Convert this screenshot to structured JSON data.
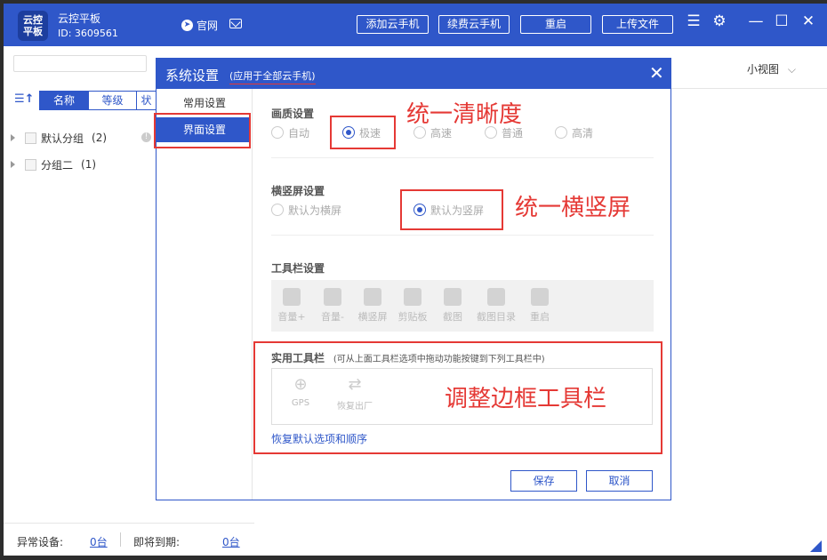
{
  "titlebar": {
    "logo_line1": "云控",
    "logo_line2": "平板",
    "app_name": "云控平板",
    "app_id": "ID: 3609561",
    "site_label": "官网",
    "buttons": [
      "添加云手机",
      "续费云手机",
      "重启",
      "上传文件"
    ]
  },
  "leftpanel": {
    "sort_tabs": [
      "名称",
      "等级",
      "状"
    ],
    "groups": [
      {
        "name": "默认分组",
        "count": "(2)"
      },
      {
        "name": "分组二",
        "count": "(1)"
      }
    ],
    "footer": {
      "abnormal_label": "异常设备:",
      "abnormal_value": "0台",
      "expiring_label": "即将到期:",
      "expiring_value": "0台"
    }
  },
  "rightarea": {
    "view_toggle": "小视图"
  },
  "dialog": {
    "title": "系统设置",
    "subtitle": "(应用于全部云手机)",
    "close": "✕",
    "side_items": [
      "常用设置",
      "界面设置"
    ],
    "quality": {
      "title": "画质设置",
      "options": [
        "自动",
        "极速",
        "高速",
        "普通",
        "高清"
      ],
      "selected": "极速"
    },
    "orientation": {
      "title": "横竖屏设置",
      "options": [
        "默认为横屏",
        "默认为竖屏"
      ],
      "selected": "默认为竖屏"
    },
    "toolbar": {
      "title": "工具栏设置",
      "tools": [
        "音量+",
        "音量-",
        "横竖屏",
        "剪贴板",
        "截图",
        "截图目录",
        "重启"
      ]
    },
    "practical": {
      "title": "实用工具栏",
      "hint": "(可从上面工具栏选项中拖动功能按键到下列工具栏中)",
      "tools": [
        "GPS",
        "恢复出厂"
      ],
      "restore_link": "恢复默认选项和顺序"
    },
    "save_label": "保存",
    "cancel_label": "取消"
  },
  "annotations": {
    "quality": "统一清晰度",
    "orientation": "统一横竖屏",
    "toolbar": "调整边框工具栏"
  },
  "colors": {
    "brand": "#2f57c9",
    "annotation": "#e53935"
  }
}
